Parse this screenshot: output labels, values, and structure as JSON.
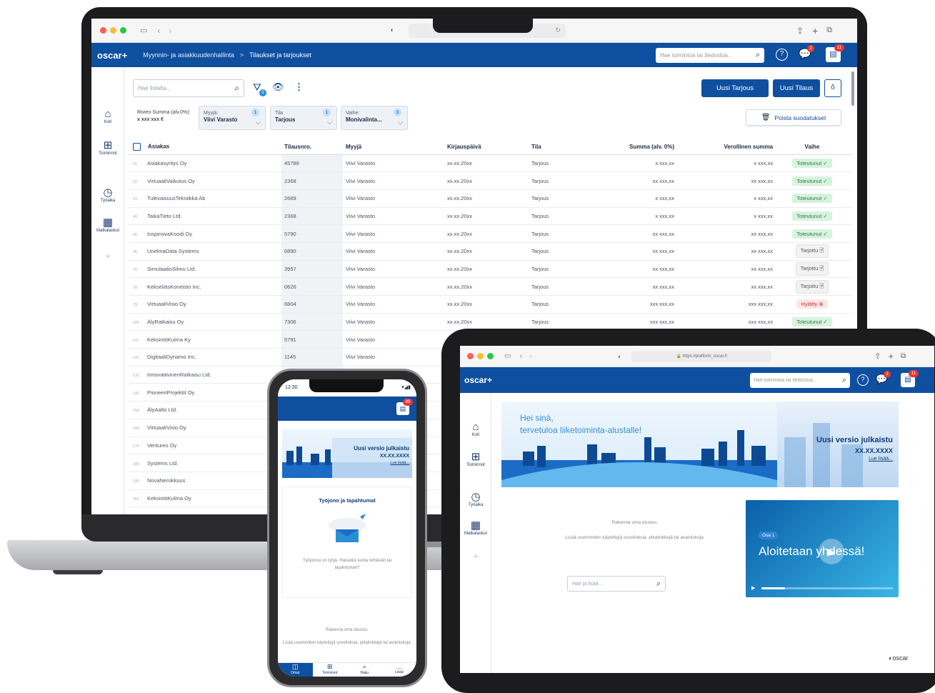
{
  "laptop": {
    "brand": "oscar+",
    "breadcrumb": {
      "section": "Myynnin- ja asiakkuudenhallinta",
      "separator": ">",
      "page": "Tilaukset ja tarjoukset"
    },
    "search_placeholder": "Hae toimintoa tai tiedostoa...",
    "chat_badge": "2",
    "notif_badge": "11",
    "sidebar": [
      {
        "label": "Koti",
        "icon": "home-icon"
      },
      {
        "label": "Toiminnot",
        "icon": "apps-icon"
      },
      {
        "label": "Työaika",
        "icon": "clock-icon"
      },
      {
        "label": "Matkalaskut",
        "icon": "receipt-icon"
      }
    ],
    "list_search_placeholder": "Hae listalta...",
    "filter_count": "5",
    "buttons": {
      "new_offer": "Uusi Tarjous",
      "new_order": "Uusi Tilaus",
      "clear_filters": "Poista suodatukset"
    },
    "sum": {
      "label": "Rivien Summa (alv.0%):",
      "value": "x xxx xxx €"
    },
    "filters": [
      {
        "label": "Myyjä:",
        "value": "Viivi Varasto",
        "count": "1"
      },
      {
        "label": "Tila",
        "value": "Tarjous",
        "count": "1"
      },
      {
        "label": "Vaihe:",
        "value": "Monivalinta...",
        "count": "3"
      }
    ],
    "columns": [
      "Asiakas",
      "Tilausnro.",
      "Myyjä",
      "Kirjauspäivä",
      "Tila",
      "Summa (alv. 0%)",
      "Verollinen summa",
      "Vaihe"
    ],
    "rows": [
      {
        "n": "21",
        "customer": "Asiakasyritys Oy",
        "order": "45789",
        "seller": "Viivi Varasto",
        "date": "xx.xx.20xx",
        "status": "Tarjous",
        "sum": "x xxx,xx",
        "gross": "x xxx,xx",
        "phase": "Toteutunut ✓",
        "kind": "ok"
      },
      {
        "n": "22",
        "customer": "VirtuaaliVaikutus Oy",
        "order": "2368",
        "seller": "Viivi Varasto",
        "date": "xx.xx.20xx",
        "status": "Tarjous",
        "sum": "xx xxx,xx",
        "gross": "xx xxx,xx",
        "phase": "Toteutunut ✓",
        "kind": "ok"
      },
      {
        "n": "23",
        "customer": "TulevaisuusTekniikka Ab",
        "order": "2689",
        "seller": "Viivi Varasto",
        "date": "xx.xx.20xx",
        "status": "Tarjous",
        "sum": "x xxx,xx",
        "gross": "x xxx,xx",
        "phase": "Toteutunut ✓",
        "kind": "ok"
      },
      {
        "n": "40",
        "customer": "TaikaTieto Ltd.",
        "order": "2368",
        "seller": "Viivi Varasto",
        "date": "xx.xx.20xx",
        "status": "Tarjous",
        "sum": "x xxx,xx",
        "gross": "x xxx,xx",
        "phase": "Toteutunut ✓",
        "kind": "ok"
      },
      {
        "n": "45",
        "customer": "InspiroivaKoodi Oy",
        "order": "5790",
        "seller": "Viivi Varasto",
        "date": "xx.xx.20xx",
        "status": "Tarjous",
        "sum": "xx xxx,xx",
        "gross": "xx xxx,xx",
        "phase": "Toteutunut ✓",
        "kind": "ok"
      },
      {
        "n": "46",
        "customer": "UnelmaData Systems",
        "order": "6890",
        "seller": "Viivi Varasto",
        "date": "xx.xx.20xx",
        "status": "Tarjous",
        "sum": "xx xxx,xx",
        "gross": "xx xxx,xx",
        "phase": "Tarjottu 🗎",
        "kind": "off"
      },
      {
        "n": "76",
        "customer": "SimulaatioSilmu Ltd.",
        "order": "3957",
        "seller": "Viivi Varasto",
        "date": "xx.xx.20xx",
        "status": "Tarjous",
        "sum": "xx xxx,xx",
        "gross": "xx xxx,xx",
        "phase": "Tarjottu 🗎",
        "kind": "off"
      },
      {
        "n": "78",
        "customer": "KekseliäsKoneisto Inc.",
        "order": "0626",
        "seller": "Viivi Varasto",
        "date": "xx.xx.20xx",
        "status": "Tarjous",
        "sum": "xx xxx,xx",
        "gross": "xx xxx,xx",
        "phase": "Tarjottu 🗎",
        "kind": "off"
      },
      {
        "n": "79",
        "customer": "VirtuaaliVisio Oy",
        "order": "6804",
        "seller": "Viivi Varasto",
        "date": "xx.xx.20xx",
        "status": "Tarjous",
        "sum": "xxx xxx,xx",
        "gross": "xxx xxx,xx",
        "phase": "Hylätty ⊗",
        "kind": "rej"
      },
      {
        "n": "101",
        "customer": "ÄlyRatkaisu Oy",
        "order": "7306",
        "seller": "Viivi Varasto",
        "date": "xx.xx.20xx",
        "status": "Tarjous",
        "sum": "xxx xxx,xx",
        "gross": "xxx xxx,xx",
        "phase": "Toteutunut ✓",
        "kind": "ok"
      },
      {
        "n": "111",
        "customer": "KeksintöKulma Ky",
        "order": "5791",
        "seller": "Viivi Varasto",
        "date": "",
        "status": "",
        "sum": "",
        "gross": "",
        "phase": "",
        "kind": ""
      },
      {
        "n": "121",
        "customer": "DigitaaliDynamo Inc.",
        "order": "1145",
        "seller": "Viivi Varasto",
        "date": "",
        "status": "",
        "sum": "",
        "gross": "",
        "phase": "",
        "kind": ""
      },
      {
        "n": "131",
        "customer": "InnovatiivinenRatkaisu Ltd.",
        "order": "",
        "seller": "",
        "date": "",
        "status": "",
        "sum": "",
        "gross": "",
        "phase": "",
        "kind": ""
      },
      {
        "n": "142",
        "customer": "PioneeriProjektit Oy",
        "order": "",
        "seller": "",
        "date": "",
        "status": "",
        "sum": "",
        "gross": "",
        "phase": "",
        "kind": ""
      },
      {
        "n": "152",
        "customer": "ÄlyAalto Ltd.",
        "order": "",
        "seller": "",
        "date": "",
        "status": "",
        "sum": "",
        "gross": "",
        "phase": "",
        "kind": ""
      },
      {
        "n": "160",
        "customer": "VirtuaaliVisio Oy",
        "order": "",
        "seller": "",
        "date": "",
        "status": "",
        "sum": "",
        "gross": "",
        "phase": "",
        "kind": ""
      },
      {
        "n": "171",
        "customer": "Ventures Oy",
        "order": "",
        "seller": "",
        "date": "",
        "status": "",
        "sum": "",
        "gross": "",
        "phase": "",
        "kind": ""
      },
      {
        "n": "183",
        "customer": "Systems Ltd.",
        "order": "",
        "seller": "",
        "date": "",
        "status": "",
        "sum": "",
        "gross": "",
        "phase": "",
        "kind": ""
      },
      {
        "n": "195",
        "customer": "NovaNerokkuus",
        "order": "",
        "seller": "",
        "date": "",
        "status": "",
        "sum": "",
        "gross": "",
        "phase": "",
        "kind": ""
      },
      {
        "n": "201",
        "customer": "KeksintöKulma Oy",
        "order": "",
        "seller": "",
        "date": "",
        "status": "",
        "sum": "",
        "gross": "",
        "phase": "",
        "kind": ""
      }
    ]
  },
  "tablet": {
    "url": "https://platform_oscar.fi",
    "brand": "oscar+",
    "search_placeholder": "Hae toimintoa tai tiedostoa...",
    "chat_badge": "2",
    "notif_badge": "11",
    "sidebar": [
      "Koti",
      "Toiminnot",
      "Työaika",
      "Matkalaskut"
    ],
    "hero": {
      "greeting": "Hei sinä,",
      "welcome": "tervetuloa liiketoiminta-alustalle!"
    },
    "release": {
      "title": "Uusi versio julkaistu",
      "version": "XX.XX.XXXX",
      "link": "Lue lisää..."
    },
    "build": {
      "title": "Rakenna oma etusivu.",
      "text": "Lisää useimmiten käytettyjä sovelluksia, pikalinkkejä tai avainlukuja."
    },
    "search_placeholder2": "Hae ja lisää...",
    "video": {
      "tag": "Osa 1",
      "title": "Aloitetaan yhdessä!"
    },
    "footer_logo": "oscar"
  },
  "phone": {
    "time": "12:30",
    "badge": "99",
    "release": {
      "title": "Uusi versio julkaistu",
      "version": "XX.XX.XXXX",
      "link": "Lue lisää..."
    },
    "queue": {
      "title": "Työjono ja tapahtumat",
      "text": "Työjonosi on tyhjä. Haluatko luoda tehtävän tai tapahtuman?"
    },
    "build": {
      "title": "Rakenna oma etusivu.",
      "text": "Lisää useimmiten käytettyjä sovelluksia, pikalinkkejä tai avainlukuja."
    },
    "nav": [
      "Omat",
      "Toiminnot",
      "Haku",
      "Lisää"
    ]
  }
}
